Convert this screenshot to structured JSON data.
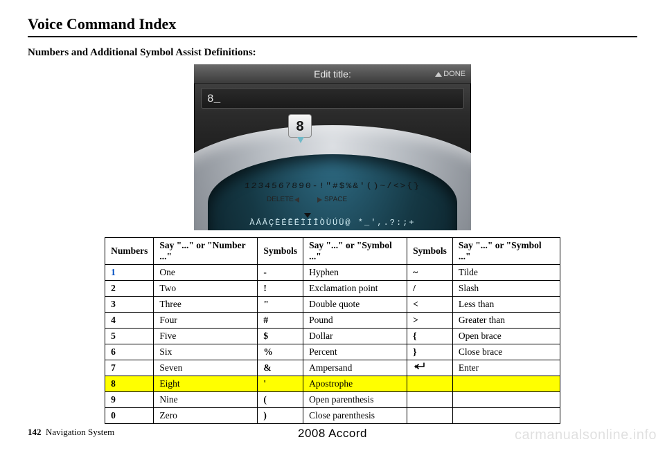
{
  "header": {
    "title": "Voice Command Index",
    "subtitle": "Numbers and Additional Symbol Assist Definitions:"
  },
  "device": {
    "titlebar": "Edit title:",
    "done_label": "DONE",
    "input_value": "8_",
    "bubble_key": "8",
    "arc_chars": "1234567890-!\"#$%&'()~/<>{}",
    "delete_label": "DELETE",
    "space_label": "SPACE",
    "alt_chars": "ÀÁÂÇÈÉÊËÌÍÎÒÙÚÜ@ *_',.?:;+"
  },
  "table": {
    "headers": {
      "h1": "Numbers",
      "h2": "Say \"...\" or \"Number ...\"",
      "h3": "Symbols",
      "h4": "Say \"...\" or \"Symbol ...\"",
      "h5": "Symbols",
      "h6": "Say \"...\" or \"Symbol ...\""
    },
    "rows": [
      {
        "num": "1",
        "say1": "One",
        "sym1": "-",
        "say2": "Hyphen",
        "sym2": "~",
        "say3": "Tilde",
        "highlight": false,
        "num_blue": true
      },
      {
        "num": "2",
        "say1": "Two",
        "sym1": "!",
        "say2": "Exclamation point",
        "sym2": "/",
        "say3": "Slash",
        "highlight": false
      },
      {
        "num": "3",
        "say1": "Three",
        "sym1": "\"",
        "say2": "Double quote",
        "sym2": "<",
        "say3": "Less than",
        "highlight": false
      },
      {
        "num": "4",
        "say1": "Four",
        "sym1": "#",
        "say2": "Pound",
        "sym2": ">",
        "say3": "Greater than",
        "highlight": false
      },
      {
        "num": "5",
        "say1": "Five",
        "sym1": "$",
        "say2": "Dollar",
        "sym2": "{",
        "say3": "Open brace",
        "highlight": false
      },
      {
        "num": "6",
        "say1": "Six",
        "sym1": "%",
        "say2": "Percent",
        "sym2": "}",
        "say3": "Close brace",
        "highlight": false
      },
      {
        "num": "7",
        "say1": "Seven",
        "sym1": "&",
        "say2": "Ampersand",
        "sym2": "↵",
        "say3": "Enter",
        "highlight": false,
        "enter_glyph": true
      },
      {
        "num": "8",
        "say1": "Eight",
        "sym1": "'",
        "say2": "Apostrophe",
        "sym2": "",
        "say3": "",
        "highlight": true
      },
      {
        "num": "9",
        "say1": "Nine",
        "sym1": "(",
        "say2": "Open parenthesis",
        "sym2": "",
        "say3": "",
        "highlight": false
      },
      {
        "num": "0",
        "say1": "Zero",
        "sym1": ")",
        "say2": "Close parenthesis",
        "sym2": "",
        "say3": "",
        "highlight": false
      }
    ]
  },
  "footer": {
    "page_number": "142",
    "section": "Navigation System",
    "model_year": "2008  Accord",
    "watermark": "carmanualsonline.info"
  }
}
